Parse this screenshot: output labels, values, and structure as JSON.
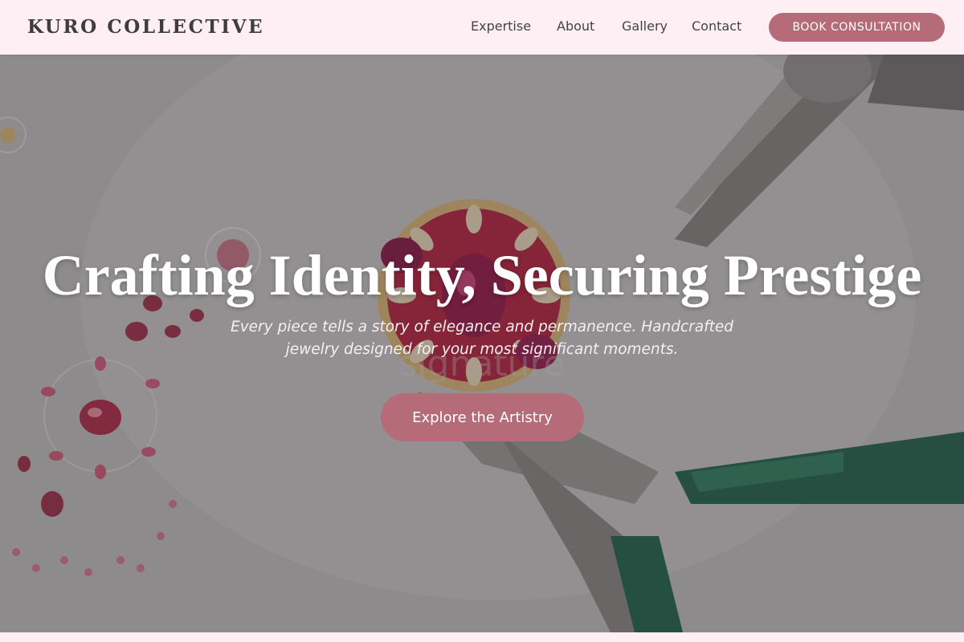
{
  "header": {
    "logo": "KURO COLLECTIVE",
    "nav": {
      "expertise": "Expertise",
      "about": "About",
      "gallery": "Gallery",
      "contact": "Contact"
    },
    "cta": "BOOK CONSULTATION"
  },
  "hero": {
    "title": "Crafting Identity, Securing Prestige",
    "subtitle": "Every piece tells a story of elegance and permanence. Handcrafted jewelry designed for your most significant moments.",
    "button": "Explore the Artistry",
    "background_image": "jewelry-ring-and-pliers-photo"
  },
  "colors": {
    "accent": "#b56c78",
    "header_bg": "#fdeff3",
    "text_dark": "#3d3d3d"
  }
}
